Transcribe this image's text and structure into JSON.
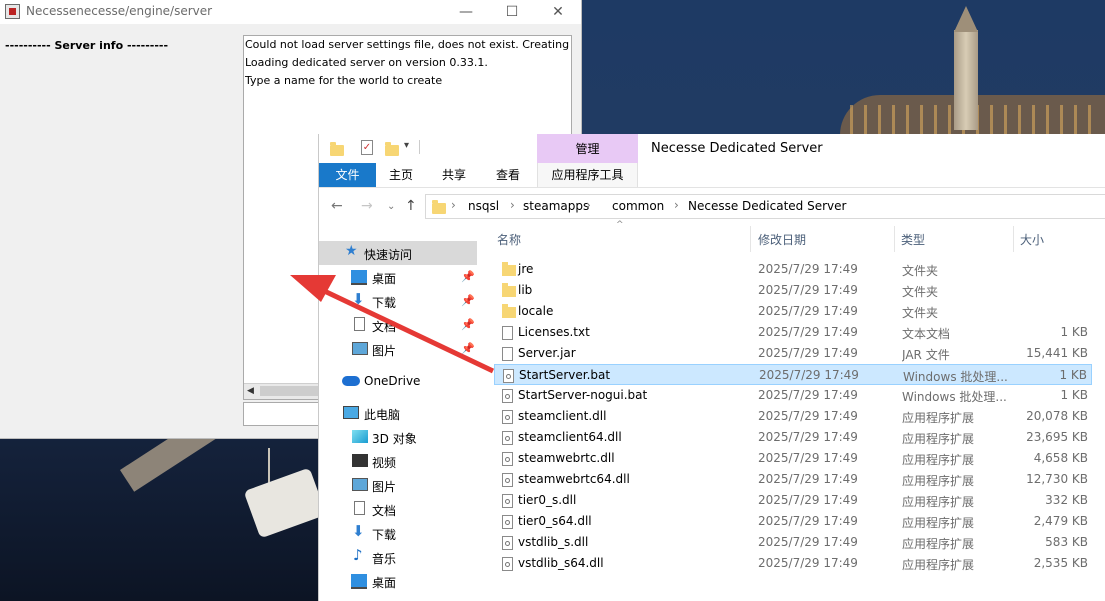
{
  "java_window": {
    "title": "Necessenecesse/engine/server",
    "server_info_label": "---------- Server info ---------",
    "log_lines": [
      "Could not load server settings file, does not exist. Creating n",
      "Loading dedicated server on version 0.33.1.",
      "Type a name for the world to create"
    ],
    "input_value": "",
    "buttons": {
      "minimize": "—",
      "maximize": "☐",
      "close": "✕"
    }
  },
  "explorer": {
    "title": "Necesse Dedicated Server",
    "manage_tab": "管理",
    "ribbon_tabs": [
      "文件",
      "主页",
      "共享",
      "查看",
      "应用程序工具"
    ],
    "breadcrumb": [
      "nsqsl",
      "steamapps",
      "common",
      "Necesse Dedicated Server"
    ],
    "columns": {
      "name": "名称",
      "date": "修改日期",
      "type": "类型",
      "size": "大小"
    },
    "nav_pane": [
      {
        "label": "快速访问",
        "icon": "star-icon",
        "pinned": false
      },
      {
        "label": "桌面",
        "icon": "desktop-icon",
        "pinned": true
      },
      {
        "label": "下载",
        "icon": "download-icon",
        "pinned": true
      },
      {
        "label": "文档",
        "icon": "document-icon",
        "pinned": true
      },
      {
        "label": "图片",
        "icon": "pictures-icon",
        "pinned": true
      },
      {
        "label": "OneDrive",
        "icon": "cloud-icon",
        "pinned": false
      },
      {
        "label": "此电脑",
        "icon": "computer-icon",
        "pinned": false
      },
      {
        "label": "3D 对象",
        "icon": "3d-objects-icon",
        "pinned": false
      },
      {
        "label": "视频",
        "icon": "video-icon",
        "pinned": false
      },
      {
        "label": "图片",
        "icon": "pictures-icon",
        "pinned": false
      },
      {
        "label": "文档",
        "icon": "document-icon",
        "pinned": false
      },
      {
        "label": "下载",
        "icon": "download-icon",
        "pinned": false
      },
      {
        "label": "音乐",
        "icon": "music-icon",
        "pinned": false
      },
      {
        "label": "桌面",
        "icon": "desktop-icon",
        "pinned": false
      }
    ],
    "files": [
      {
        "name": "jre",
        "date": "2025/7/29 17:49",
        "type": "文件夹",
        "size": "",
        "icon": "folder"
      },
      {
        "name": "lib",
        "date": "2025/7/29 17:49",
        "type": "文件夹",
        "size": "",
        "icon": "folder"
      },
      {
        "name": "locale",
        "date": "2025/7/29 17:49",
        "type": "文件夹",
        "size": "",
        "icon": "folder"
      },
      {
        "name": "Licenses.txt",
        "date": "2025/7/29 17:49",
        "type": "文本文档",
        "size": "1 KB",
        "icon": "page"
      },
      {
        "name": "Server.jar",
        "date": "2025/7/29 17:49",
        "type": "JAR 文件",
        "size": "15,441 KB",
        "icon": "page"
      },
      {
        "name": "StartServer.bat",
        "date": "2025/7/29 17:49",
        "type": "Windows 批处理...",
        "size": "1 KB",
        "icon": "gear",
        "selected": true
      },
      {
        "name": "StartServer-nogui.bat",
        "date": "2025/7/29 17:49",
        "type": "Windows 批处理...",
        "size": "1 KB",
        "icon": "gear"
      },
      {
        "name": "steamclient.dll",
        "date": "2025/7/29 17:49",
        "type": "应用程序扩展",
        "size": "20,078 KB",
        "icon": "gear"
      },
      {
        "name": "steamclient64.dll",
        "date": "2025/7/29 17:49",
        "type": "应用程序扩展",
        "size": "23,695 KB",
        "icon": "gear"
      },
      {
        "name": "steamwebrtc.dll",
        "date": "2025/7/29 17:49",
        "type": "应用程序扩展",
        "size": "4,658 KB",
        "icon": "gear"
      },
      {
        "name": "steamwebrtc64.dll",
        "date": "2025/7/29 17:49",
        "type": "应用程序扩展",
        "size": "12,730 KB",
        "icon": "gear"
      },
      {
        "name": "tier0_s.dll",
        "date": "2025/7/29 17:49",
        "type": "应用程序扩展",
        "size": "332 KB",
        "icon": "gear"
      },
      {
        "name": "tier0_s64.dll",
        "date": "2025/7/29 17:49",
        "type": "应用程序扩展",
        "size": "2,479 KB",
        "icon": "gear"
      },
      {
        "name": "vstdlib_s.dll",
        "date": "2025/7/29 17:49",
        "type": "应用程序扩展",
        "size": "583 KB",
        "icon": "gear"
      },
      {
        "name": "vstdlib_s64.dll",
        "date": "2025/7/29 17:49",
        "type": "应用程序扩展",
        "size": "2,535 KB",
        "icon": "gear"
      }
    ]
  },
  "colors": {
    "accent": "#1979ca",
    "selection": "#cce8ff",
    "manage_tab": "#e8c9f5",
    "annotation_arrow": "#e53935"
  }
}
